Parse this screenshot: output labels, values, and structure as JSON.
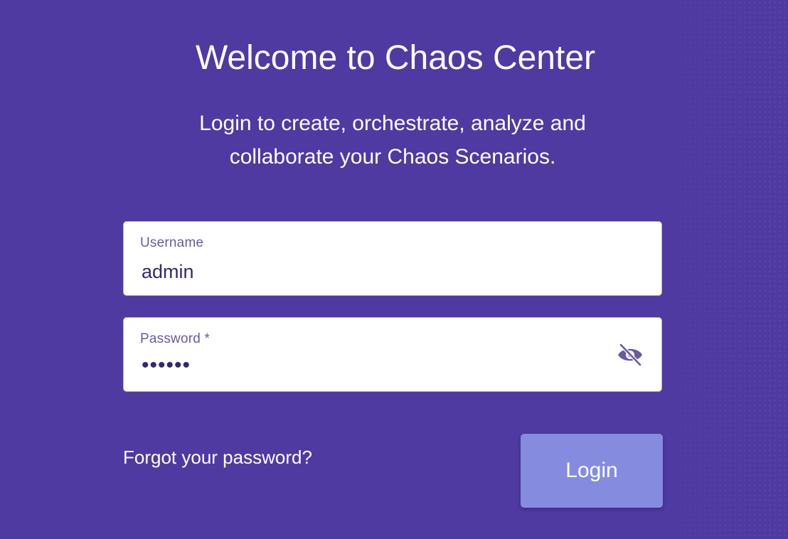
{
  "header": {
    "title": "Welcome to Chaos Center",
    "subtitle": "Login to create, orchestrate, analyze and collaborate your Chaos Scenarios."
  },
  "form": {
    "username": {
      "label": "Username",
      "value": "admin"
    },
    "password": {
      "label": "Password *",
      "value": "••••••",
      "toggle_icon": "eye-off-icon"
    },
    "forgot_password": "Forgot your password?",
    "login_button": "Login"
  },
  "colors": {
    "background": "#4f3aa2",
    "button": "#858ce0",
    "input_text": "#35296e",
    "label": "#6b5aa0"
  }
}
